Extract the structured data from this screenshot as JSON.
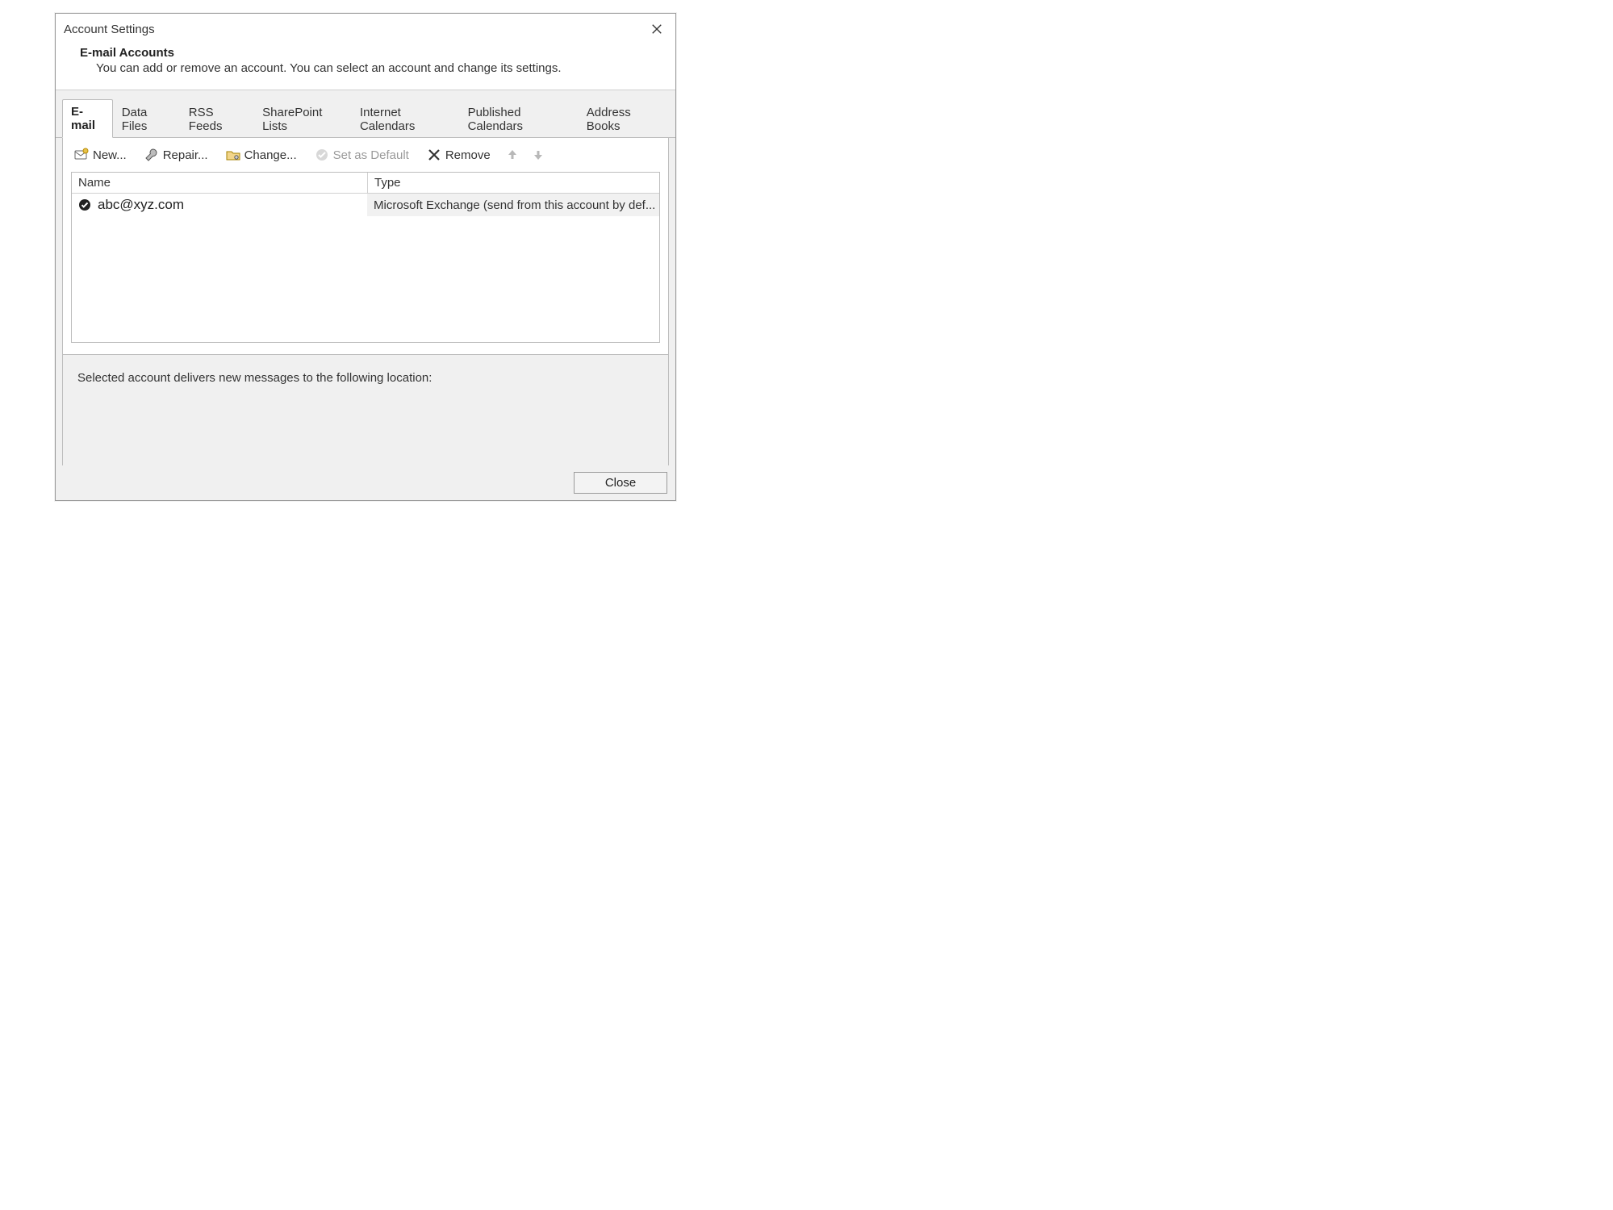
{
  "window": {
    "title": "Account Settings"
  },
  "header": {
    "heading": "E-mail Accounts",
    "subtext": "You can add or remove an account. You can select an account and change its settings."
  },
  "tabs": [
    {
      "label": "E-mail",
      "active": true
    },
    {
      "label": "Data Files"
    },
    {
      "label": "RSS Feeds"
    },
    {
      "label": "SharePoint Lists"
    },
    {
      "label": "Internet Calendars"
    },
    {
      "label": "Published Calendars"
    },
    {
      "label": "Address Books"
    }
  ],
  "toolbar": {
    "new": "New...",
    "repair": "Repair...",
    "change": "Change...",
    "set_default": "Set as Default",
    "remove": "Remove"
  },
  "columns": {
    "name": "Name",
    "type": "Type"
  },
  "accounts": [
    {
      "name": "abc@xyz.com",
      "type": "Microsoft Exchange (send from this account by def...",
      "is_default": true
    }
  ],
  "delivery_label": "Selected account delivers new messages to the following location:",
  "footer": {
    "close": "Close"
  }
}
